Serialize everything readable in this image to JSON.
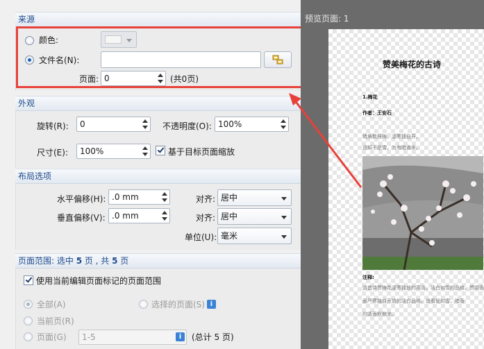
{
  "source": {
    "title": "来源",
    "color_label": "颜色:",
    "filename_label": "文件名(N):",
    "filename_value": "",
    "page_label": "页面:",
    "page_value": "0",
    "page_total": "(共0页)"
  },
  "appearance": {
    "title": "外观",
    "rotation_label": "旋转(R):",
    "rotation_value": "0",
    "opacity_label": "不透明度(O):",
    "opacity_value": "100%",
    "size_label": "尺寸(E):",
    "size_value": "100%",
    "scale_check_label": "基于目标页面缩放",
    "scale_checked": true
  },
  "layout": {
    "title": "布局选项",
    "h_offset_label": "水平偏移(H):",
    "h_offset_value": ".0 mm",
    "v_offset_label": "垂直偏移(V):",
    "v_offset_value": ".0 mm",
    "align_label_1": "对齐:",
    "align_value_1": "居中",
    "align_label_2": "对齐:",
    "align_value_2": "居中",
    "unit_label": "单位(U):",
    "unit_value": "毫米"
  },
  "page_range": {
    "title_prefix": "页面范围: 选中 ",
    "selected_count": "5",
    "title_mid": " 页 , 共 ",
    "total_count": "5",
    "title_suffix": " 页",
    "use_marked_label": "使用当前编辑页面标记的页面范围",
    "use_marked_checked": true,
    "all_label": "全部(A)",
    "selected_pages_label": "选择的页面(S)",
    "current_page_label": "当前页(R)",
    "pages_label": "页面(G)",
    "pages_value": "1-5",
    "pages_total": "(总计 5 页)"
  },
  "preview": {
    "header": "预览页面: 1",
    "doc_title": "赞美梅花的古诗",
    "section": "1.梅花",
    "author": "作者：王安石",
    "line1": "墙角数枝梅，凌寒独自开。",
    "line2": "遥知不是雪，为有暗香来。",
    "note_title": "注释:",
    "note1": "这首诗赞梅花凌寒独放的高洁，洁白如雪的品格，赞颂香气",
    "note2": "香严寒独自开放的洁白品格，遥看犹如雪，暗香",
    "note3": "的清香默默来。"
  },
  "colors": {
    "highlight": "#e8413a",
    "group_title": "#1f4b8c"
  }
}
